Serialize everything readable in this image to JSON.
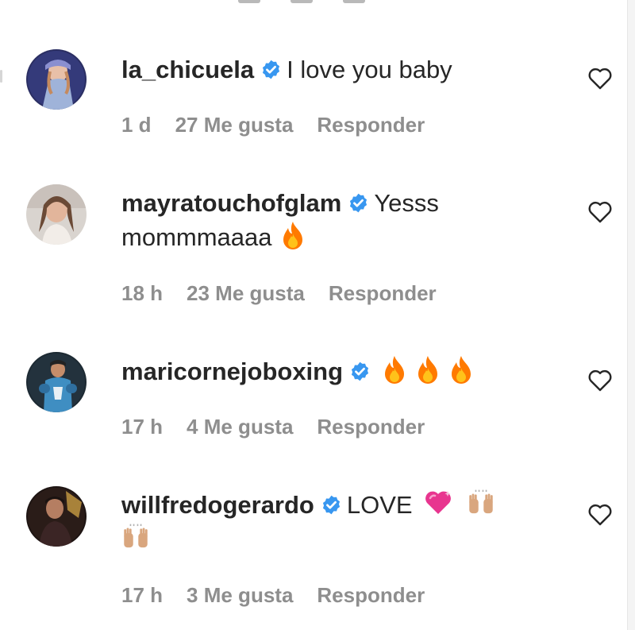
{
  "comments": [
    {
      "username": "la_chicuela",
      "text": "I love you baby",
      "verified": true,
      "time": "1 d",
      "likes": "27 Me gusta",
      "reply": "Responder",
      "emoji_after": []
    },
    {
      "username": "mayratouchofglam",
      "text": "Yesss",
      "text_line2": "mommmaaaa",
      "verified": true,
      "time": "18 h",
      "likes": "23 Me gusta",
      "reply": "Responder",
      "emoji_after": [
        "fire"
      ]
    },
    {
      "username": "maricornejoboxing",
      "text": "",
      "verified": true,
      "time": "17 h",
      "likes": "4 Me gusta",
      "reply": "Responder",
      "emoji_after": [
        "fire",
        "fire",
        "fire"
      ]
    },
    {
      "username": "willfredogerardo",
      "text": "LOVE",
      "verified": true,
      "time": "17 h",
      "likes": "3 Me gusta",
      "reply": "Responder",
      "emoji_after": [
        "sparkling-heart",
        "raising-hands",
        "raising-hands"
      ]
    }
  ],
  "icons": {
    "verified": "verified-badge-icon",
    "like": "heart-outline-icon",
    "fire": "fire-emoji-icon",
    "heart_emoji": "sparkling-heart-emoji-icon",
    "hands": "raising-hands-emoji-icon"
  },
  "colors": {
    "username": "#262626",
    "meta": "#8e8e8e",
    "verified": "#3897f0",
    "fire": "#ff6a00",
    "heart_emoji": "#e8358f"
  }
}
